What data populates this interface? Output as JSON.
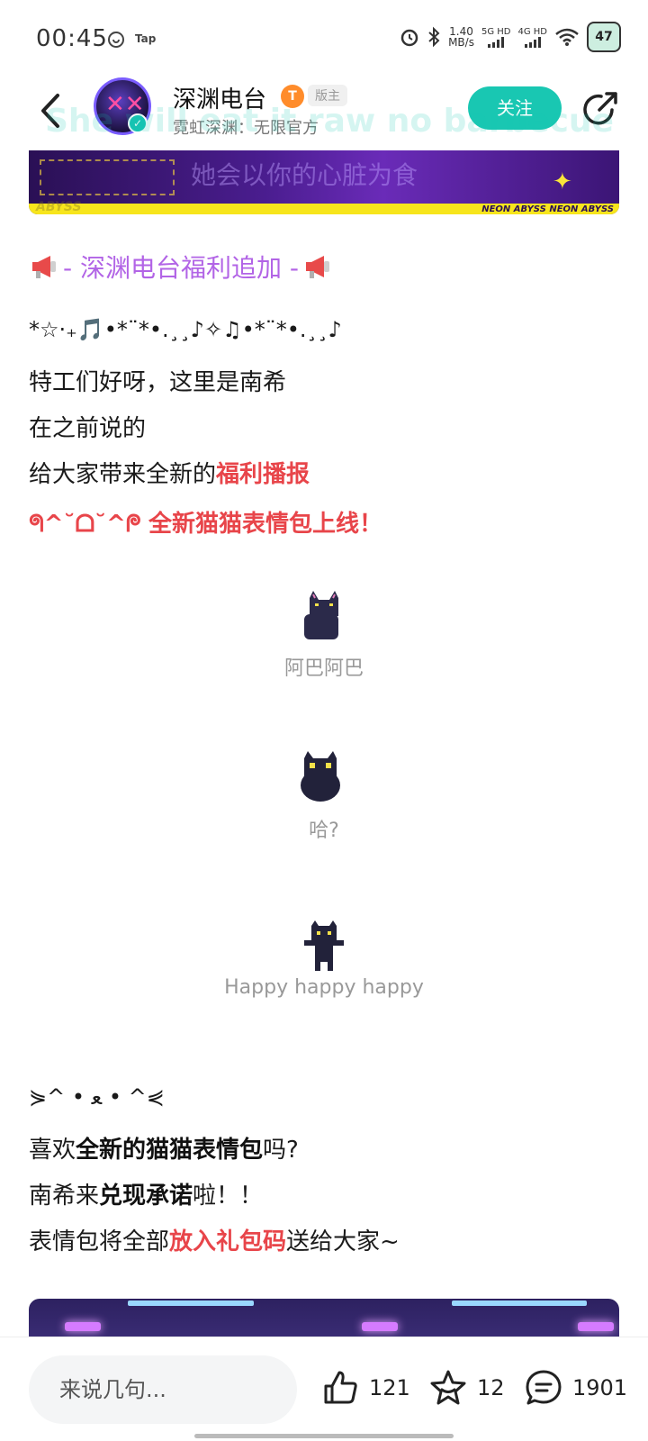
{
  "status_bar": {
    "time": "00:45",
    "tap_label": "Tap",
    "net_speed_value": "1.40",
    "net_speed_unit": "MB/s",
    "sim1": "5G HD",
    "sim2": "4G HD",
    "battery": "47"
  },
  "header": {
    "channel_name": "深渊电台",
    "badge_t": "T",
    "role_badge": "版主",
    "subtitle": "霓虹深渊：无限官方",
    "follow_label": "关注",
    "overlay_text": "She will eat it raw no barbecue"
  },
  "banner": {
    "caption": "她会以你的心脏为食",
    "neon_text": "NEON ABYSS NEON ABYSS",
    "abyss_text": "ABYSS"
  },
  "article": {
    "section_title": "- 深渊电台福利追加 -",
    "deco_line": "*☆·₊🎵•*¨*•.¸¸♪✧♫•*¨*•.¸¸♪",
    "line1": "特工们好呀，这里是南希",
    "line2": "在之前说的",
    "line3_prefix": "给大家带来全新的",
    "line3_highlight": "福利播报",
    "line4_kaomoji": "ᖗ^˘ᗝ˘^ᖘ",
    "line4_highlight": "全新猫猫表情包上线！",
    "stickers": [
      {
        "caption": "阿巴阿巴"
      },
      {
        "caption": "哈?"
      },
      {
        "caption": "Happy happy happy"
      }
    ],
    "kaomoji2": "⋟^ • ﻌ • ^⋞",
    "q_prefix": "喜欢",
    "q_bold": "全新的猫猫表情包",
    "q_suffix": "吗?",
    "p_prefix": "南希来",
    "p_bold": "兑现承诺",
    "p_suffix": "啦！！",
    "g_prefix": "表情包将全部",
    "g_highlight": "放入礼包码",
    "g_suffix": "送给大家~"
  },
  "bottom_bar": {
    "comment_placeholder": "来说几句...",
    "like_count": "121",
    "favorite_count": "12",
    "comment_count": "1901"
  },
  "colors": {
    "accent": "#19c7b2",
    "highlight_red": "#e8454a",
    "section_purple": "#b264e6"
  }
}
